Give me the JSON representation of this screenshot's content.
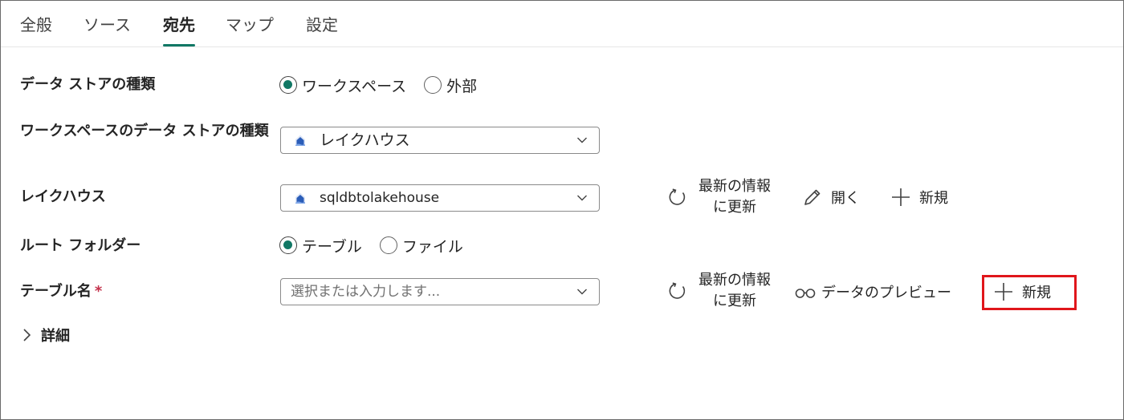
{
  "tabs": [
    {
      "label": "全般"
    },
    {
      "label": "ソース"
    },
    {
      "label": "宛先"
    },
    {
      "label": "マップ"
    },
    {
      "label": "設定"
    }
  ],
  "active_tab": "宛先",
  "form": {
    "store_type": {
      "label": "データ ストアの種類",
      "options": [
        "ワークスペース",
        "外部"
      ],
      "selected": "ワークスペース"
    },
    "workspace_store_type": {
      "label": "ワークスペースのデータ ストアの種類",
      "value": "レイクハウス"
    },
    "lakehouse": {
      "label": "レイクハウス",
      "value": "sqldbtolakehouse",
      "refresh_label": "最新の情報に更新",
      "open_label": "開く",
      "new_label": "新規"
    },
    "root_folder": {
      "label": "ルート フォルダー",
      "options": [
        "テーブル",
        "ファイル"
      ],
      "selected": "テーブル"
    },
    "table_name": {
      "label": "テーブル名",
      "required_mark": "*",
      "placeholder": "選択または入力します...",
      "refresh_label": "最新の情報に更新",
      "preview_label": "データのプレビュー",
      "new_label": "新規"
    },
    "details_label": "詳細"
  },
  "colors": {
    "accent": "#117865",
    "highlight": "#e0161b",
    "lakehouse_icon": "#2b5db8"
  }
}
